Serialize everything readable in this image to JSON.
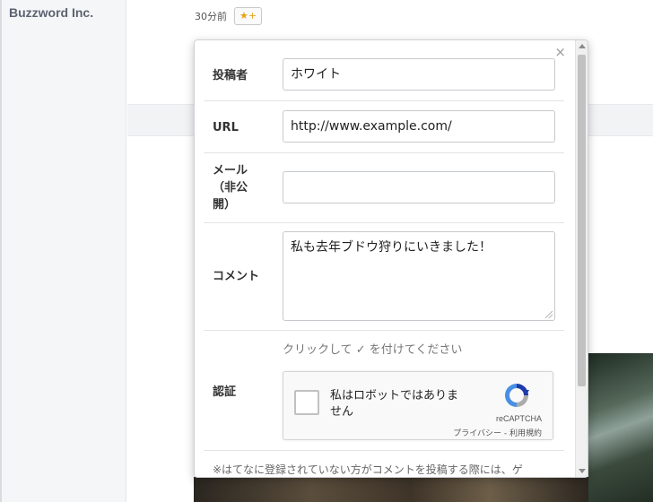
{
  "page": {
    "blog_name": "Buzzword Inc.",
    "time_ago": "30分前",
    "star_label": "★+"
  },
  "modal": {
    "close_symbol": "×",
    "author": {
      "label": "投稿者",
      "value": "ホワイト"
    },
    "url": {
      "label": "URL",
      "value": "http://www.example.com/"
    },
    "email": {
      "label": "メール（非公開）",
      "label_lines": [
        "メール",
        "（非公",
        "開）"
      ],
      "value": ""
    },
    "comment": {
      "label": "コメント",
      "value": "私も去年ブドウ狩りにいきました！"
    },
    "captcha": {
      "label": "認証",
      "hint": "クリックして ✓ を付けてください",
      "checkbox_text": "私はロボットではありません",
      "brand": "reCAPTCHA",
      "links": "プライバシー - 利用規約"
    },
    "notice": "※はてなに登録されていない方がコメントを投稿する際には、ゲ"
  },
  "colors": {
    "star": "#e7a21b",
    "recaptcha_blue": "#1c3aa9",
    "recaptcha_lightblue": "#4a90e2",
    "recaptcha_gray": "#ababab"
  }
}
